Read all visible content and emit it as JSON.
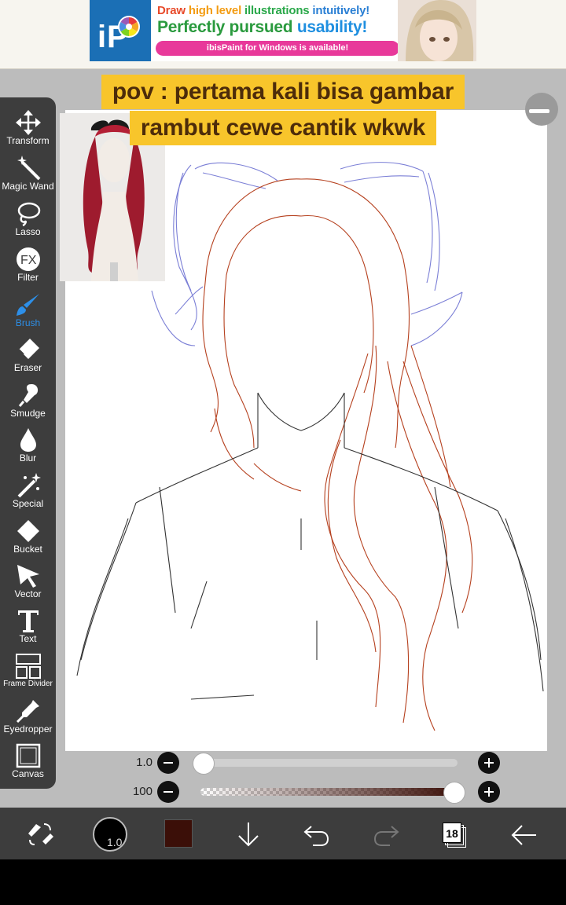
{
  "ad": {
    "line1_a": "Draw ",
    "line1_b": "high level ",
    "line1_c": "illustrations ",
    "line1_d": "intuitively!",
    "line2_a": "Perfectly pursued ",
    "line2_b": "usability!",
    "pill": "ibisPaint for Windows is available!"
  },
  "caption": {
    "line1": "pov : pertama kali bisa gambar",
    "line2": "rambut cewe cantik wkwk"
  },
  "tools": [
    {
      "label": "Transform",
      "icon": "move-icon"
    },
    {
      "label": "Magic Wand",
      "icon": "magic-wand-icon"
    },
    {
      "label": "Lasso",
      "icon": "lasso-icon"
    },
    {
      "label": "Filter",
      "icon": "fx-icon"
    },
    {
      "label": "Brush",
      "icon": "brush-icon",
      "active": true
    },
    {
      "label": "Eraser",
      "icon": "eraser-icon"
    },
    {
      "label": "Smudge",
      "icon": "smudge-icon"
    },
    {
      "label": "Blur",
      "icon": "drop-icon"
    },
    {
      "label": "Special",
      "icon": "special-icon"
    },
    {
      "label": "Bucket",
      "icon": "bucket-icon"
    },
    {
      "label": "Vector",
      "icon": "cursor-icon"
    },
    {
      "label": "Text",
      "icon": "text-icon"
    },
    {
      "label": "Frame Divider",
      "icon": "frame-divider-icon"
    },
    {
      "label": "Eyedropper",
      "icon": "eyedropper-icon"
    },
    {
      "label": "Canvas",
      "icon": "canvas-icon"
    }
  ],
  "sliders": {
    "size": {
      "value": "1.0",
      "fraction": 0.0
    },
    "opacity": {
      "value": "100",
      "fraction": 1.0
    }
  },
  "bottom": {
    "brush_size": "1.0",
    "color": "#3b0f08",
    "layer_count": "18"
  },
  "colors": {
    "toolbar": "#3d3d3d",
    "active": "#2d8fe8",
    "caption_bg": "#f8c52b",
    "hair_stroke": "#b5401e",
    "bow_stroke": "#7b7fd6"
  }
}
